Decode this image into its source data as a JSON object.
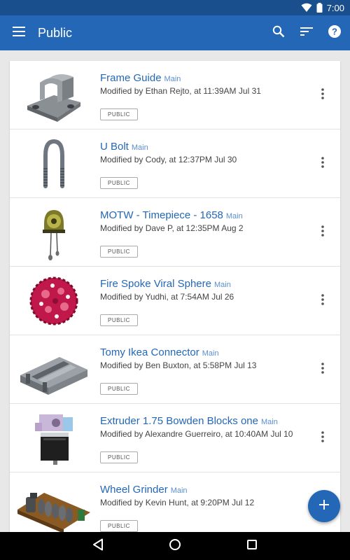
{
  "status": {
    "time": "7:00"
  },
  "header": {
    "title": "Public"
  },
  "documents": [
    {
      "title": "Frame Guide",
      "branch": "Main",
      "meta": "Modified by Ethan Rejto, at 11:39AM Jul 31",
      "badge": "PUBLIC",
      "thumb": "frame-guide-thumbnail"
    },
    {
      "title": "U Bolt",
      "branch": "Main",
      "meta": "Modified by Cody, at 12:37PM Jul 30",
      "badge": "PUBLIC",
      "thumb": "u-bolt-thumbnail"
    },
    {
      "title": "MOTW - Timepiece - 1658",
      "branch": "Main",
      "meta": "Modified by Dave P, at 12:35PM Aug 2",
      "badge": "PUBLIC",
      "thumb": "timepiece-thumbnail"
    },
    {
      "title": "Fire Spoke Viral Sphere",
      "branch": "Main",
      "meta": "Modified by Yudhi, at 7:54AM Jul 26",
      "badge": "PUBLIC",
      "thumb": "viral-sphere-thumbnail"
    },
    {
      "title": "Tomy Ikea Connector",
      "branch": "Main",
      "meta": "Modified by Ben Buxton, at 5:58PM Jul 13",
      "badge": "PUBLIC",
      "thumb": "ikea-connector-thumbnail"
    },
    {
      "title": "Extruder 1.75 Bowden Blocks one",
      "branch": "Main",
      "meta": "Modified by Alexandre Guerreiro, at 10:40AM Jul 10",
      "badge": "PUBLIC",
      "thumb": "extruder-thumbnail"
    },
    {
      "title": "Wheel Grinder",
      "branch": "Main",
      "meta": "Modified by Kevin Hunt, at 9:20PM Jul 12",
      "badge": "PUBLIC",
      "thumb": "wheel-grinder-thumbnail"
    }
  ],
  "colors": {
    "primary": "#2467b6",
    "status_bar": "#1a4f8e",
    "title_link": "#2467b6"
  }
}
